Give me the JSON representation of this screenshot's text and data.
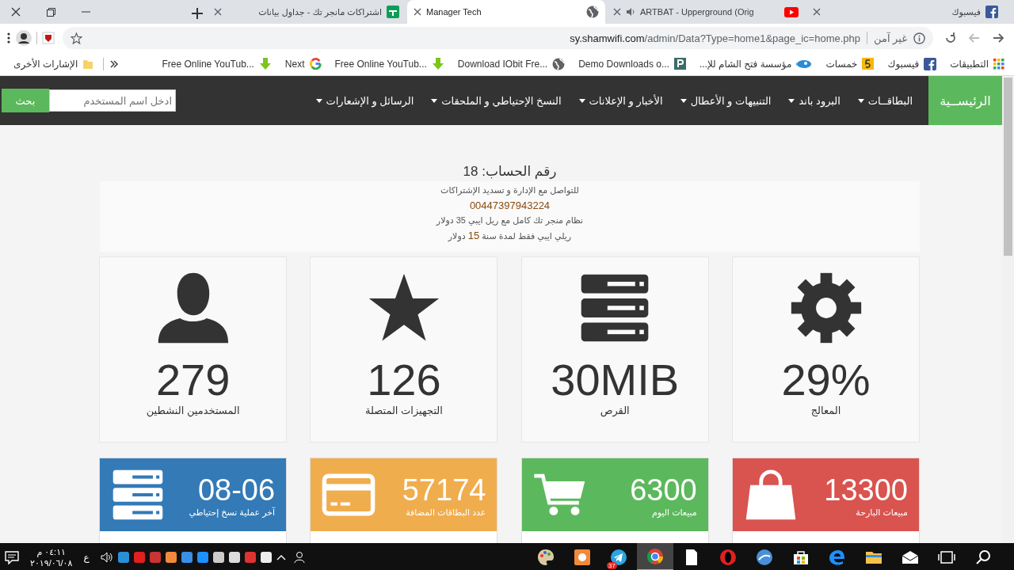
{
  "tabs": [
    {
      "title": "فيسبوك",
      "kind": "facebook",
      "audio": false,
      "selected": false
    },
    {
      "title": "ARTBAT - Upperground (Orig",
      "kind": "youtube",
      "audio": true,
      "selected": false
    },
    {
      "title": "Manager Tech",
      "kind": "globe",
      "audio": false,
      "selected": true
    },
    {
      "title": "اشتراكات مانجر تك - جداول بيانات",
      "kind": "sheets",
      "audio": false,
      "selected": false
    }
  ],
  "nav_buttons": [
    {
      "kind": "back",
      "disabled": false
    },
    {
      "kind": "forward",
      "disabled": true
    },
    {
      "kind": "reload",
      "disabled": false
    }
  ],
  "address_bar": {
    "security": "غير آمن",
    "host": "sy.shamwifi.com",
    "path": "/admin/Data?Type=home1&page_ic=home.php"
  },
  "bookmarks": [
    {
      "label": "التطبيقات",
      "kind": "apps"
    },
    {
      "label": "فيسبوك",
      "kind": "facebook"
    },
    {
      "label": "خمسات",
      "kind": "five"
    },
    {
      "label": "مؤسسة فتح الشام للإ...",
      "kind": "eye"
    },
    {
      "label": "Demo Downloads o...",
      "kind": "p"
    },
    {
      "label": "Download IObit Fre...",
      "kind": "globe"
    },
    {
      "label": "Free Online YouTub...",
      "kind": "download"
    },
    {
      "label": "Next",
      "kind": "google"
    },
    {
      "label": "Free Online YouTub...",
      "kind": "download"
    }
  ],
  "other_bookmarks": "الإشارات الأخرى",
  "nav": {
    "brand": "الرئيســية",
    "items": [
      "البطاقــات",
      "البرود باند",
      "التنبيهات و الأعطال",
      "الأخبار و الإعلانات",
      "النسخ الإحتياطي و الملحقات",
      "الرسائل و الإشعارات"
    ],
    "search_placeholder": "ادخل اسم المستخدم",
    "search_button": "بحث"
  },
  "account": {
    "title": "رقم الحساب: 18",
    "lines": [
      {
        "kind": "text",
        "text": "للتواصل مع الإدارة و تسديد الإشتراكات"
      },
      {
        "kind": "phone",
        "text": "00447397943224"
      },
      {
        "kind": "text",
        "text": "نظام منجر تك كامل مع ريل ايبي 35 دولار"
      },
      {
        "kind": "price",
        "before": "ريلي ايبي فقط لمدة سنة",
        "price": "15",
        "after": "دولار"
      }
    ]
  },
  "stats": [
    {
      "kind": "gear",
      "value": "29%",
      "label": "المعالج"
    },
    {
      "kind": "server",
      "value": "30MIB",
      "label": "القرص"
    },
    {
      "kind": "star",
      "value": "126",
      "label": "التجهيزات المتصلة"
    },
    {
      "kind": "user",
      "value": "279",
      "label": "المستخدمين النشطين"
    }
  ],
  "tiles": [
    {
      "kind": "bag",
      "color": "#d9534f",
      "value": "13300",
      "label": "مبيعات البارحة"
    },
    {
      "kind": "cart",
      "color": "#5cb85c",
      "value": "6300",
      "label": "مبيعات اليوم"
    },
    {
      "kind": "card",
      "color": "#f0ad4e",
      "value": "57174",
      "label": "عدد البطاقات المضافة"
    },
    {
      "kind": "server",
      "color": "#337ab7",
      "value": "08-06",
      "label": "آخر عملية نسخ إحتياطي"
    }
  ],
  "taskbar": {
    "time": "٠٤:١١ م",
    "date": "٢٠١٩/٠٦/٠٨",
    "language": "ع",
    "apps": [
      {
        "kind": "search",
        "selected": false
      },
      {
        "kind": "taskview",
        "selected": false
      },
      {
        "kind": "mail",
        "selected": false
      },
      {
        "kind": "explorer",
        "selected": false
      },
      {
        "kind": "edge",
        "selected": false
      },
      {
        "kind": "store",
        "selected": false
      },
      {
        "kind": "bluecircle",
        "selected": false
      },
      {
        "kind": "opera",
        "selected": false
      },
      {
        "kind": "file",
        "selected": false
      },
      {
        "kind": "chrome",
        "selected": true
      },
      {
        "kind": "telegram",
        "selected": false,
        "badge": "37"
      },
      {
        "kind": "orange",
        "selected": false
      },
      {
        "kind": "paint",
        "selected": false
      }
    ]
  }
}
